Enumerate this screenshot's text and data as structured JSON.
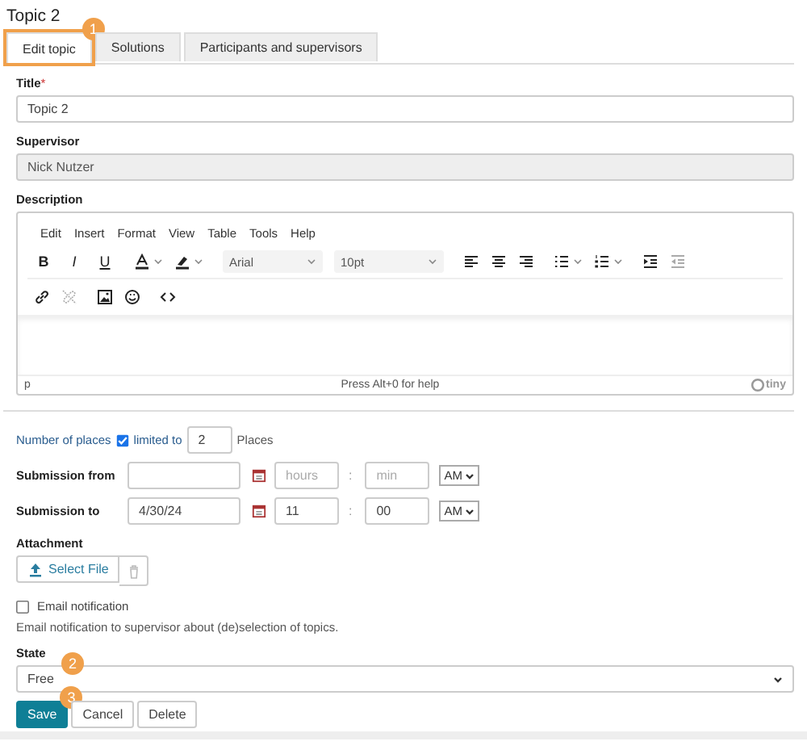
{
  "page_title": "Topic 2",
  "tabs": [
    {
      "label": "Edit topic",
      "selected": true,
      "highlighted": true,
      "callout": "1"
    },
    {
      "label": "Solutions",
      "selected": false,
      "highlighted": false
    },
    {
      "label": "Participants and supervisors",
      "selected": false,
      "highlighted": false
    }
  ],
  "title_field": {
    "label": "Title",
    "required_mark": "*",
    "value": "Topic 2"
  },
  "supervisor_field": {
    "label": "Supervisor",
    "value": "Nick Nutzer",
    "disabled": true
  },
  "description": {
    "label": "Description",
    "menu": [
      "Edit",
      "Insert",
      "Format",
      "View",
      "Table",
      "Tools",
      "Help"
    ],
    "toolbar_rows": [
      [
        [
          {
            "kind": "text",
            "label": "B"
          },
          {
            "kind": "text",
            "label": "I"
          },
          {
            "kind": "text",
            "label": "U"
          }
        ],
        [
          {
            "kind": "icon",
            "dropdown": true,
            "disabled": false
          },
          {
            "kind": "icon",
            "dropdown": true,
            "disabled": false
          }
        ],
        [
          {
            "kind": "select",
            "value": "Arial"
          },
          {
            "kind": "select",
            "value": "10pt"
          }
        ],
        [
          {
            "kind": "icon",
            "dropdown": false,
            "disabled": false
          },
          {
            "kind": "icon",
            "dropdown": false,
            "disabled": false
          },
          {
            "kind": "icon",
            "dropdown": false,
            "disabled": false
          }
        ],
        [
          {
            "kind": "icon",
            "dropdown": true,
            "disabled": false
          },
          {
            "kind": "icon",
            "dropdown": true,
            "disabled": false
          }
        ],
        [
          {
            "kind": "icon",
            "dropdown": false,
            "disabled": false
          },
          {
            "kind": "icon",
            "dropdown": false,
            "disabled": true
          }
        ]
      ],
      [
        [
          {
            "kind": "icon",
            "dropdown": false,
            "disabled": false
          },
          {
            "kind": "icon",
            "dropdown": false,
            "disabled": true
          }
        ],
        [
          {
            "kind": "icon",
            "dropdown": false,
            "disabled": false
          },
          {
            "kind": "icon",
            "dropdown": false,
            "disabled": false
          }
        ],
        [
          {
            "kind": "icon",
            "dropdown": false,
            "disabled": false
          }
        ]
      ]
    ],
    "path": "p",
    "help": "Press Alt+0 for help",
    "brand": "tiny"
  },
  "places": {
    "label": "Number of places",
    "checked": true,
    "limit_label": "limited to",
    "value": "2",
    "unit": "Places"
  },
  "submission_rows": [
    {
      "label": "Submission from",
      "hours_placeholder": "hours",
      "separator": ":",
      "minutes_placeholder": "min",
      "ampm": "AM"
    },
    {
      "label": "Submission to",
      "date": "4/30/24",
      "hours": "11",
      "separator": ":",
      "minutes": "00",
      "ampm": "AM"
    }
  ],
  "attachment": {
    "label": "Attachment",
    "button": "Select File"
  },
  "email": {
    "label": "Email notification",
    "checked": false,
    "help": "Email notification to supervisor about (de)selection of topics."
  },
  "state": {
    "label": "State",
    "value": "Free",
    "callout": "2"
  },
  "buttons": [
    {
      "label": "Save",
      "kind": "primary",
      "callout": "3"
    },
    {
      "label": "Cancel",
      "kind": "default"
    },
    {
      "label": "Delete",
      "kind": "default"
    }
  ]
}
